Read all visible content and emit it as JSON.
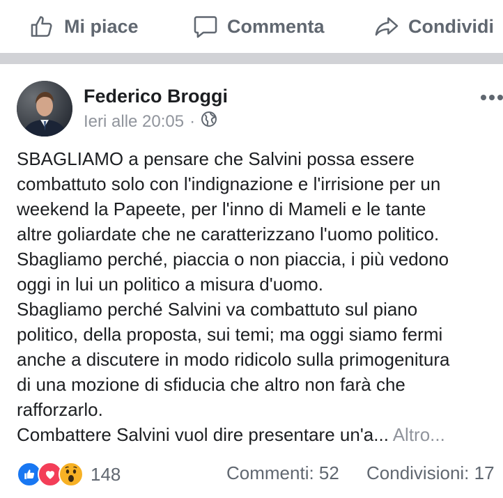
{
  "actions": {
    "like_label": "Mi piace",
    "comment_label": "Commenta",
    "share_label": "Condividi"
  },
  "post": {
    "author": "Federico Broggi",
    "timestamp": "Ieri alle 20:05",
    "meta_separator": "·",
    "audience_icon": "globe-icon",
    "body_lines": [
      "SBAGLIAMO a pensare che Salvini possa essere",
      "combattuto solo con l'indignazione e l'irrisione per un",
      "weekend la Papeete, per l'inno di Mameli e le tante",
      "altre goliardate che ne caratterizzano l'uomo politico.",
      "Sbagliamo perché, piaccia o non piaccia, i più vedono",
      "oggi in lui un politico a misura d'uomo.",
      "Sbagliamo perché Salvini va combattuto sul piano",
      "politico, della proposta, sui temi; ma oggi siamo fermi",
      "anche a discutere in modo ridicolo sulla primogenitura",
      "di una mozione di sfiducia che altro non farà che",
      "rafforzarlo.",
      "Combattere Salvini vuol dire presentare un'a..."
    ],
    "see_more": "Altro...",
    "reactions": [
      "like-reaction-icon",
      "love-reaction-icon",
      "wow-reaction-icon"
    ],
    "reaction_count": "148",
    "comments": "Commenti: 52",
    "shares": "Condivisioni: 17"
  },
  "colors": {
    "action_gray": "#606770",
    "secondary_text": "#90949c",
    "separator": "#d1d2d6",
    "like_blue": "#1877f2",
    "love_red": "#f33e58",
    "wow_yellow": "#f7b125"
  }
}
